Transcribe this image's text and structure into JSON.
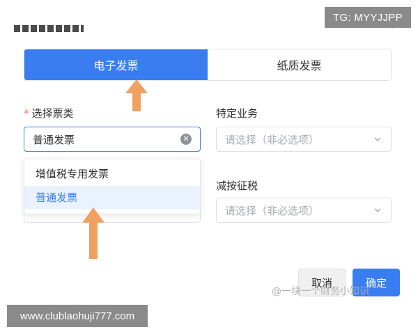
{
  "overlay": {
    "tg_handle": "TG: MYYJJPP",
    "website": "www.clublaohuji777.com",
    "watermark": "@一块一个财务小知识"
  },
  "invoice_type_tabs": [
    {
      "label": "电子发票",
      "active": true
    },
    {
      "label": "纸质发票",
      "active": false
    }
  ],
  "form": {
    "invoice_category": {
      "label": "选择票类",
      "required_mark": "*",
      "value": "普通发票",
      "options": [
        {
          "label": "增值税专用发票",
          "selected": false
        },
        {
          "label": "普通发票",
          "selected": true
        }
      ]
    },
    "special_business": {
      "label": "特定业务",
      "placeholder": "请选择（非必选项）"
    },
    "reduced_tax": {
      "label": "减按征税",
      "placeholder": "请选择（非必选项）"
    }
  },
  "buttons": {
    "cancel": "取消",
    "confirm": "确定"
  },
  "colors": {
    "primary": "#3a7df0",
    "annotation_arrow": "#f0a060",
    "required": "#f56c6c"
  }
}
